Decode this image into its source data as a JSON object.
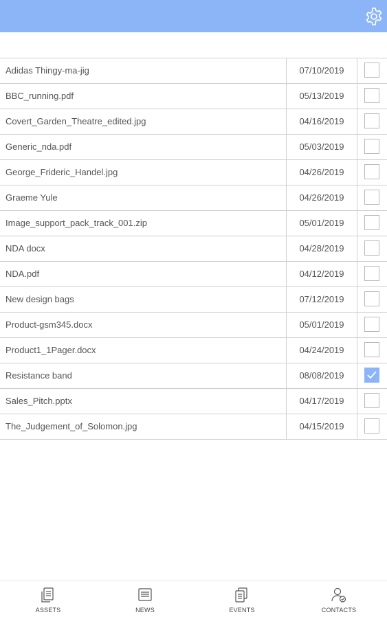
{
  "header": {
    "settings_icon": "gear-icon",
    "accent_color": "#8cb5f7"
  },
  "files": [
    {
      "name": "Adidas Thingy-ma-jig",
      "date": "07/10/2019",
      "checked": false
    },
    {
      "name": "BBC_running.pdf",
      "date": "05/13/2019",
      "checked": false
    },
    {
      "name": "Covert_Garden_Theatre_edited.jpg",
      "date": "04/16/2019",
      "checked": false
    },
    {
      "name": "Generic_nda.pdf",
      "date": "05/03/2019",
      "checked": false
    },
    {
      "name": "George_Frideric_Handel.jpg",
      "date": "04/26/2019",
      "checked": false
    },
    {
      "name": "Graeme Yule",
      "date": "04/26/2019",
      "checked": false
    },
    {
      "name": "Image_support_pack_track_001.zip",
      "date": "05/01/2019",
      "checked": false
    },
    {
      "name": "NDA docx",
      "date": "04/28/2019",
      "checked": false
    },
    {
      "name": "NDA.pdf",
      "date": "04/12/2019",
      "checked": false
    },
    {
      "name": "New design bags",
      "date": "07/12/2019",
      "checked": false
    },
    {
      "name": "Product-gsm345.docx",
      "date": "05/01/2019",
      "checked": false
    },
    {
      "name": "Product1_1Pager.docx",
      "date": "04/24/2019",
      "checked": false
    },
    {
      "name": "Resistance band",
      "date": "08/08/2019",
      "checked": true
    },
    {
      "name": "Sales_Pitch.pptx",
      "date": "04/17/2019",
      "checked": false
    },
    {
      "name": "The_Judgement_of_Solomon.jpg",
      "date": "04/15/2019",
      "checked": false
    }
  ],
  "bottom_nav": {
    "items": [
      {
        "label": "ASSETS",
        "icon": "assets-icon"
      },
      {
        "label": "NEWS",
        "icon": "news-icon"
      },
      {
        "label": "EVENTS",
        "icon": "events-icon"
      },
      {
        "label": "CONTACTS",
        "icon": "contacts-icon"
      }
    ]
  }
}
